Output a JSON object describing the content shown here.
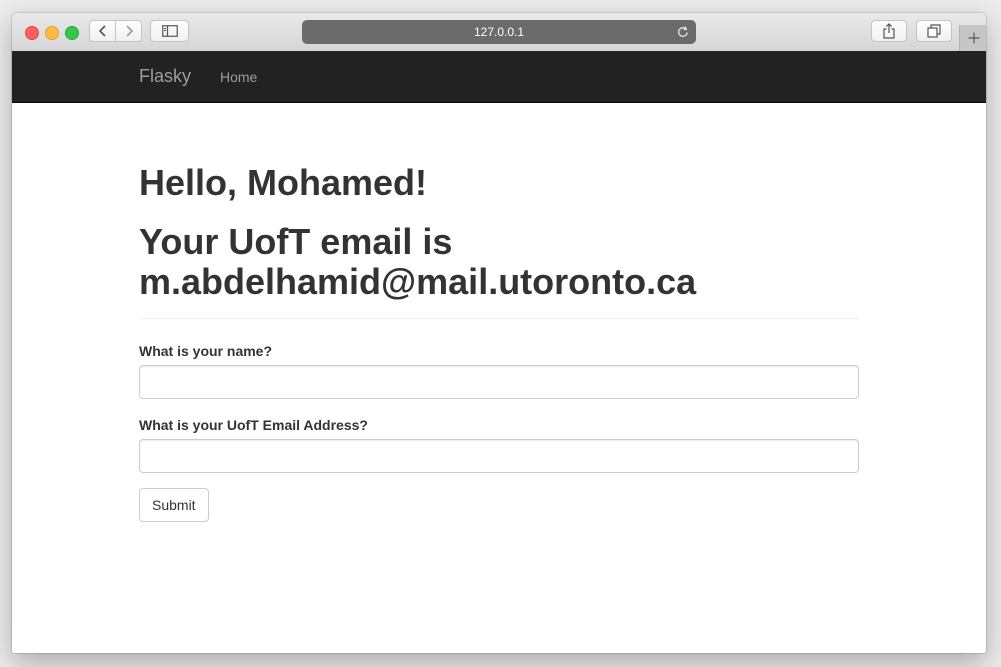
{
  "browser": {
    "url": "127.0.0.1",
    "icons": {
      "back": "chevron-left-icon",
      "forward": "chevron-right-icon",
      "sidebar": "sidebar-icon",
      "reload": "reload-icon",
      "share": "share-icon",
      "tabs": "tabs-icon",
      "new_tab": "plus-icon"
    }
  },
  "navbar": {
    "brand": "Flasky",
    "links": [
      "Home"
    ]
  },
  "main": {
    "greeting": "Hello, Mohamed!",
    "email_line1": "Your UofT email is",
    "email_line2": "m.abdelhamid@mail.utoronto.ca"
  },
  "form": {
    "name_label": "What is your name?",
    "name_value": "",
    "email_label": "What is your UofT Email Address?",
    "email_value": "",
    "submit_label": "Submit"
  },
  "colors": {
    "navbar_bg": "#222222",
    "navbar_text": "#9d9d9d",
    "heading_text": "#333333",
    "url_bar_bg": "#6b6b6b"
  }
}
